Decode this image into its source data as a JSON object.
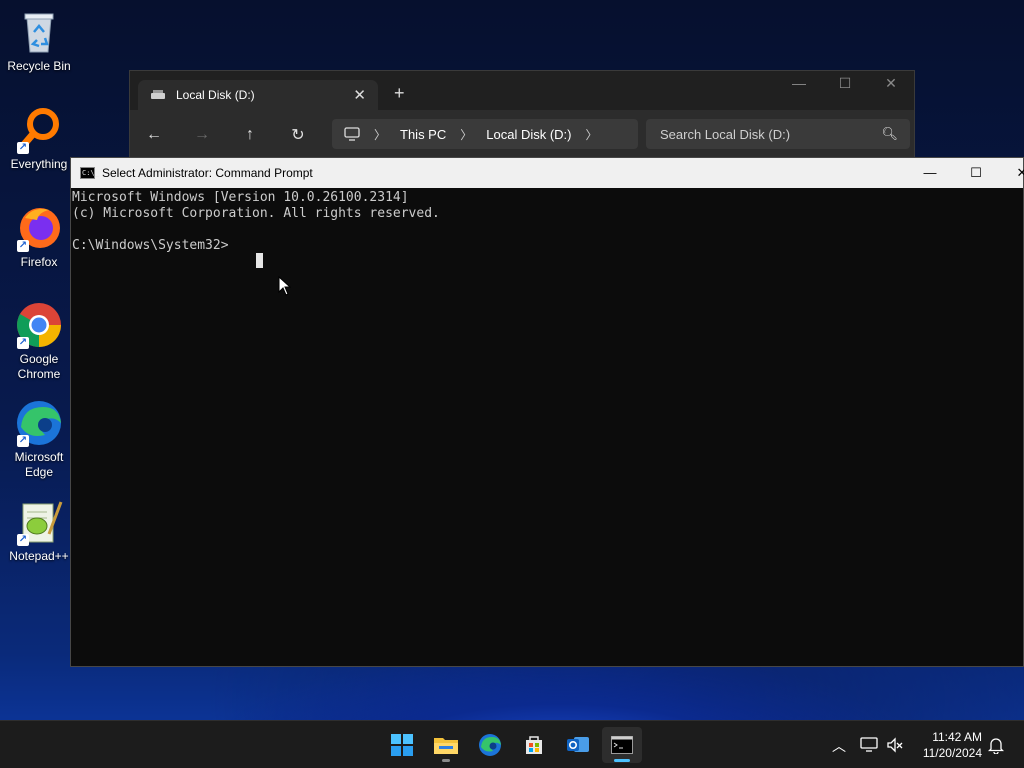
{
  "desktop": {
    "icons": [
      {
        "label": "Recycle Bin"
      },
      {
        "label": "Everything"
      },
      {
        "label": "Firefox"
      },
      {
        "label": "Google Chrome"
      },
      {
        "label": "Microsoft Edge"
      },
      {
        "label": "Notepad++"
      }
    ]
  },
  "explorer": {
    "tab_title": "Local Disk (D:)",
    "tab_close": "✕",
    "new_tab": "+",
    "breadcrumb": [
      "This PC",
      "Local Disk (D:)"
    ],
    "search_placeholder": "Search Local Disk (D:)"
  },
  "cmd": {
    "title": "Select Administrator: Command Prompt",
    "lines": [
      "Microsoft Windows [Version 10.0.26100.2314]",
      "(c) Microsoft Corporation. All rights reserved.",
      "",
      "C:\\Windows\\System32>"
    ]
  },
  "taskbar": {
    "time": "11:42 AM",
    "date": "11/20/2024"
  },
  "colors": {
    "accent": "#4cc2ff",
    "console_bg": "#0c0c0c",
    "console_text": "#cccccc",
    "taskbar_bg": "#1c1c1c"
  }
}
